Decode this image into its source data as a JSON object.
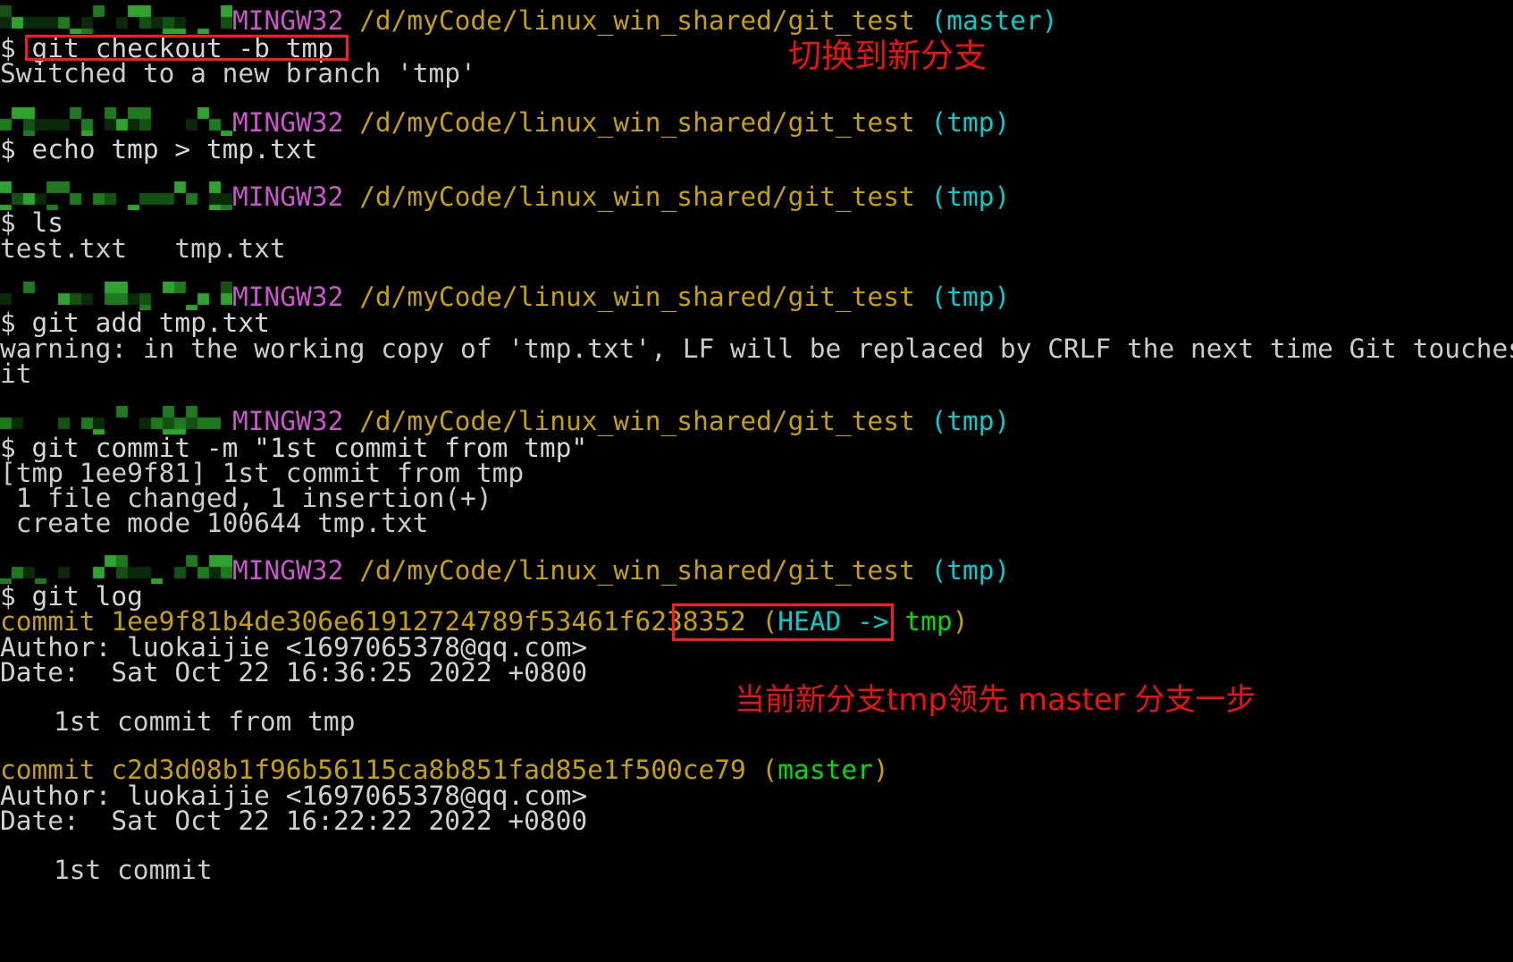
{
  "terminal": {
    "shell_name": "MINGW32",
    "path": "/d/myCode/linux_win_shared/git_test",
    "prompt_symbol": "$",
    "username_masked": "[redacted]",
    "colors": {
      "background": "#000000",
      "text": "#d0d0d0",
      "shell_name": "#cc55cc",
      "path": "#c6a100",
      "branch": "#00cdcd",
      "annotation": "#ee1111",
      "box_border": "#ff1a1a",
      "green_ref": "#00dd00",
      "commit_hash": "#c6a100"
    }
  },
  "blocks": [
    {
      "id": "block-1",
      "branch": "(master)",
      "command": "git checkout -b tmp",
      "output": [
        "Switched to a new branch 'tmp'"
      ]
    },
    {
      "id": "block-2",
      "branch": "(tmp)",
      "command": "echo tmp > tmp.txt",
      "output": []
    },
    {
      "id": "block-3",
      "branch": "(tmp)",
      "command": "ls",
      "output": [
        "test.txt   tmp.txt"
      ]
    },
    {
      "id": "block-4",
      "branch": "(tmp)",
      "command": "git add tmp.txt",
      "output": [
        "warning: in the working copy of 'tmp.txt', LF will be replaced by CRLF the next time Git touches",
        "it"
      ]
    },
    {
      "id": "block-5",
      "branch": "(tmp)",
      "command": "git commit -m \"1st commit from tmp\"",
      "output": [
        "[tmp 1ee9f81] 1st commit from tmp",
        " 1 file changed, 1 insertion(+)",
        " create mode 100644 tmp.txt"
      ]
    },
    {
      "id": "block-6",
      "branch": "(tmp)",
      "command": "git log",
      "output": []
    }
  ],
  "git_log": {
    "commits": [
      {
        "commit_label": "commit",
        "hash": "1ee9f81b4de306e61912724789f53461f6238352",
        "ref_open": "(",
        "ref_head": "HEAD -> ",
        "ref_branch": "tmp",
        "ref_close": ")",
        "author_label": "Author:",
        "author": "luokaijie <1697065378@qq.com>",
        "date_label": "Date:",
        "date": "  Sat Oct 22 16:36:25 2022 +0800",
        "message": "1st commit from tmp"
      },
      {
        "commit_label": "commit",
        "hash": "c2d3d08b1f96b56115ca8b851fad85e1f500ce79",
        "ref_open": "(",
        "ref_head": "",
        "ref_branch": "master",
        "ref_close": ")",
        "author_label": "Author:",
        "author": "luokaijie <1697065378@qq.com>",
        "date_label": "Date:",
        "date": "  Sat Oct 22 16:22:22 2022 +0800",
        "message": "1st commit"
      }
    ]
  },
  "annotations": [
    {
      "id": "note-switch-branch",
      "text": "切换到新分支"
    },
    {
      "id": "note-ahead",
      "text": "当前新分支tmp领先 master 分支一步"
    }
  ]
}
